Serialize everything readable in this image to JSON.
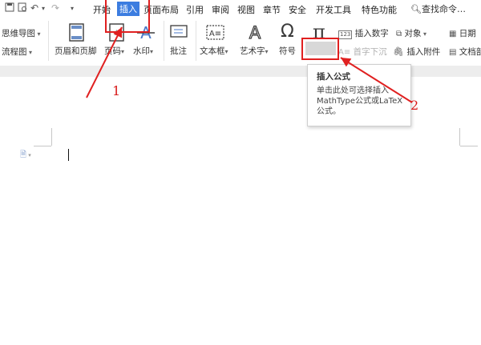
{
  "menubar": {
    "tabs": [
      "开始",
      "插入",
      "页面布局",
      "引用",
      "审阅",
      "视图",
      "章节",
      "安全",
      "开发工具",
      "特色功能"
    ],
    "search": "查找命令"
  },
  "ribbon": {
    "mindmap": "思维导图",
    "flowchart": "流程图",
    "header_footer": "页眉和页脚",
    "page_number": "页码",
    "watermark": "水印",
    "comment": "批注",
    "textbox": "文本框",
    "wordart": "艺术字",
    "symbol": "符号",
    "formula": "公式",
    "insert_number": "插入数字",
    "object": "对象",
    "dropcap": "首字下沉",
    "insert_attachment": "插入附件",
    "date": "日期",
    "doc_part": "文档部"
  },
  "tooltip": {
    "title": "插入公式",
    "description": "单击此处可选择插入MathType公式或LaTeX公式。"
  },
  "annotations": {
    "n1": "1",
    "n2": "2",
    "color": "#e02020"
  },
  "colors": {
    "accent": "#3c7de0",
    "annotation_red": "#e02020"
  }
}
